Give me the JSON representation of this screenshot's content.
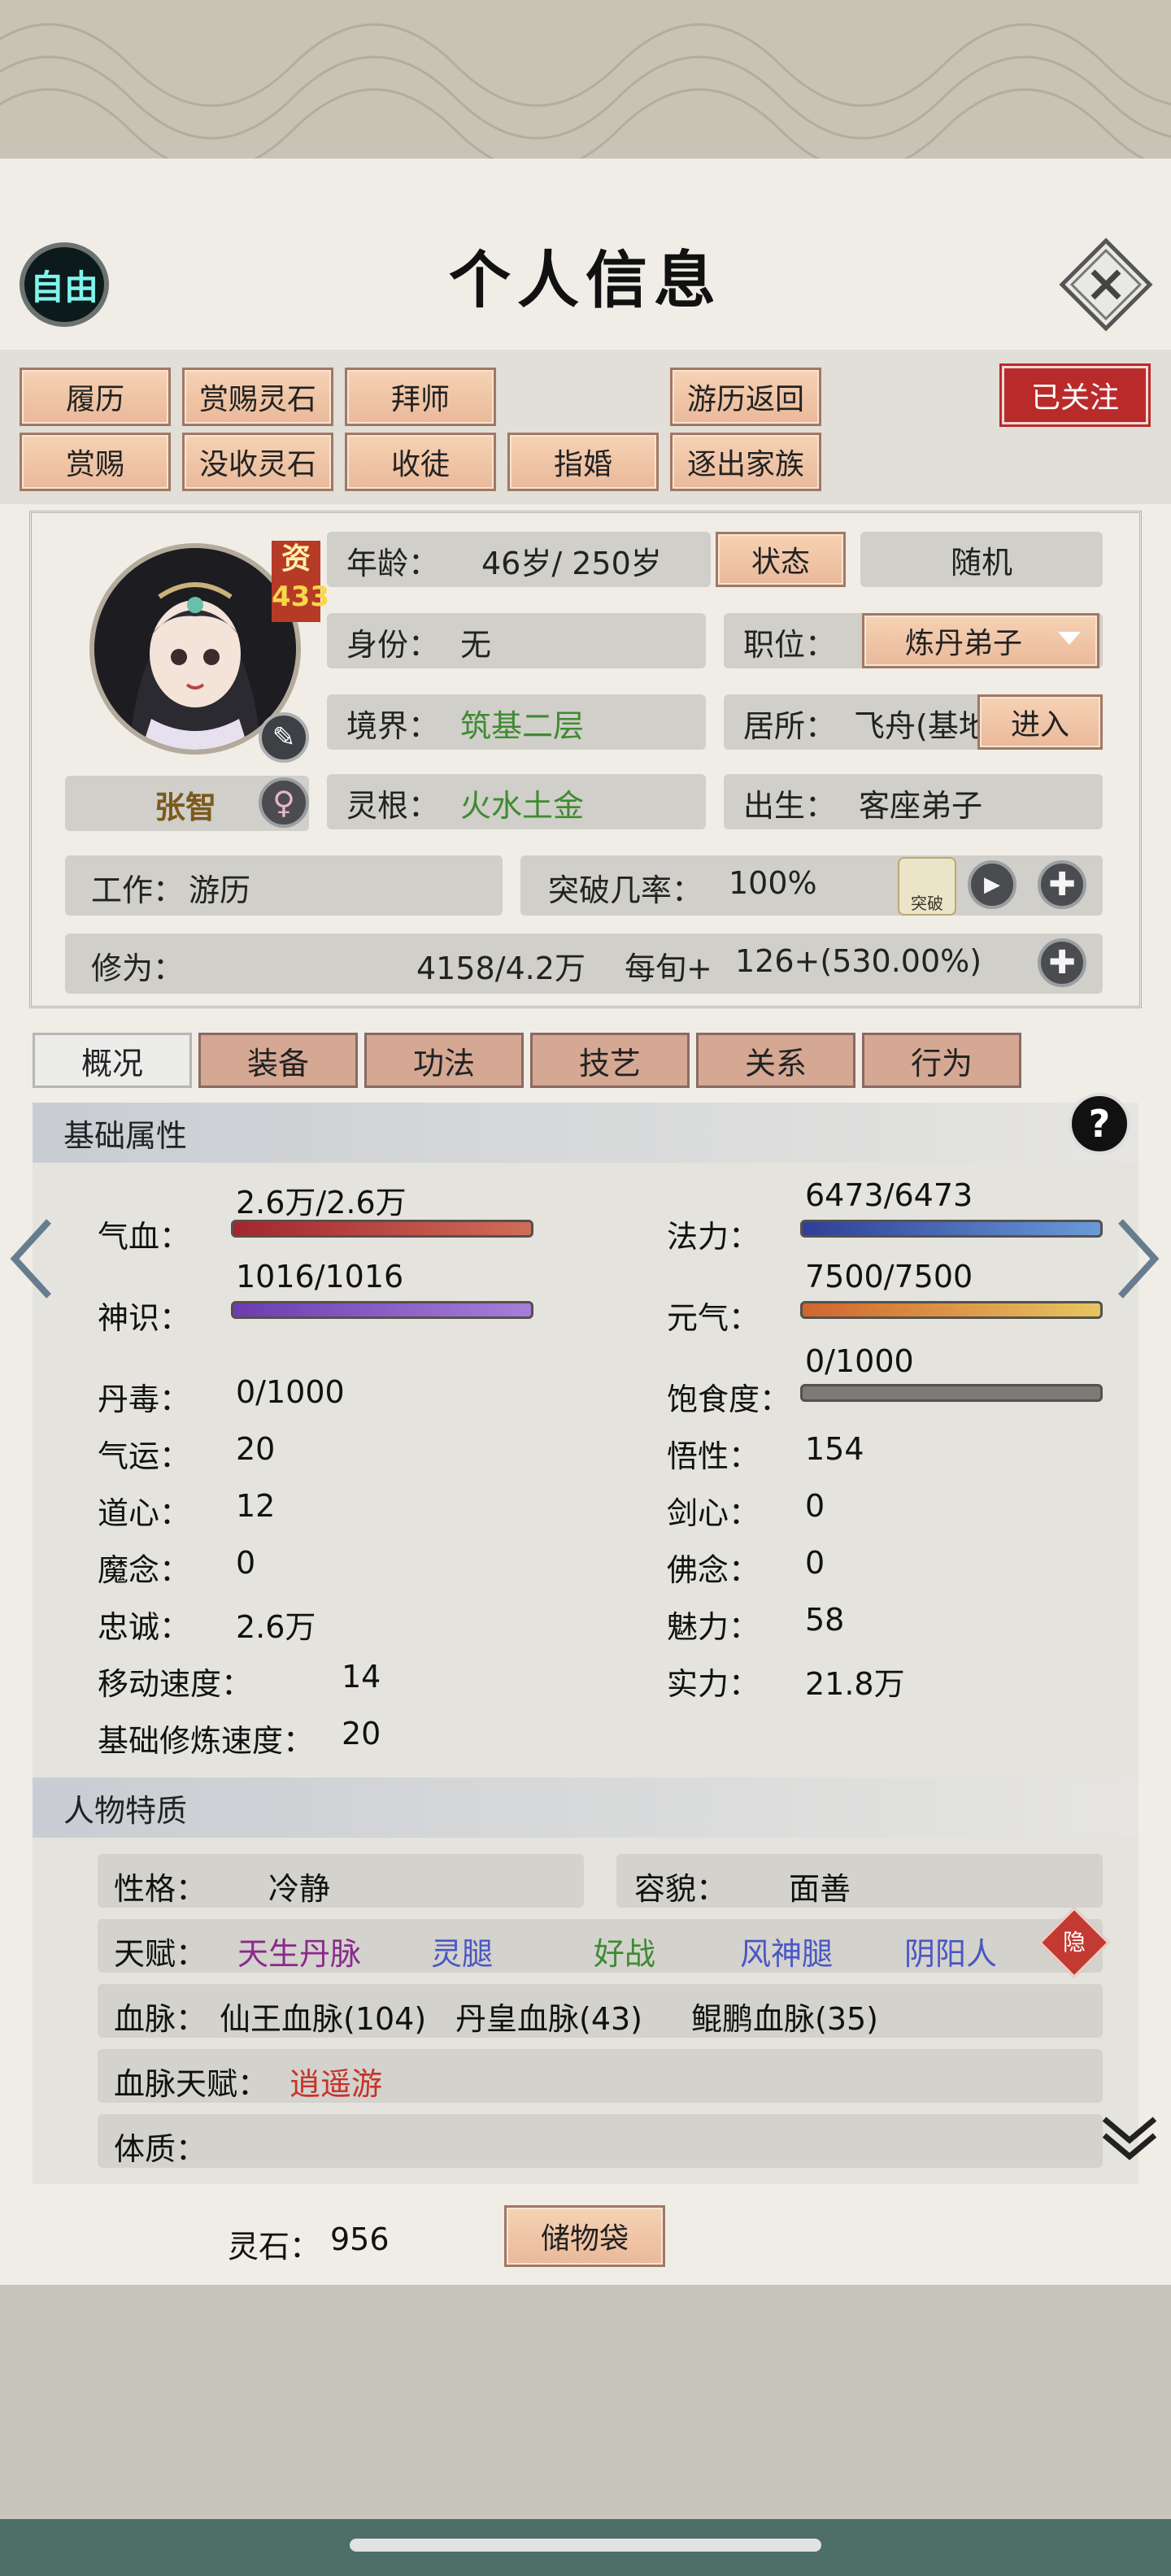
{
  "header": {
    "free_label": "自由",
    "title": "个人信息",
    "close_icon": "close-icon"
  },
  "actions": {
    "row1": [
      "履历",
      "赏赐灵石",
      "拜师",
      "游历返回"
    ],
    "row2": [
      "赏赐",
      "没收灵石",
      "收徒",
      "指婚",
      "逐出家族"
    ],
    "follow": "已关注"
  },
  "profile": {
    "aptitude_label": "资",
    "aptitude_value": "433",
    "name": "张智",
    "age_label": "年龄：",
    "age_value": "46岁/ 250岁",
    "state_button": "状态",
    "random_button": "随机",
    "identity_label": "身份：",
    "identity_value": "无",
    "position_label": "职位：",
    "position_value": "炼丹弟子",
    "realm_label": "境界：",
    "realm_value": "筑基二层",
    "residence_label": "居所：",
    "residence_value": "飞舟(基地",
    "enter_button": "进入",
    "root_label": "灵根：",
    "root_value": "火水土金",
    "birth_label": "出生：",
    "birth_value": "客座弟子",
    "work_label": "工作：",
    "work_value": "游历",
    "breakthrough_label": "突破几率：",
    "breakthrough_value": "100%",
    "breakthrough_icon_text": "突破",
    "cultivation_label": "修为：",
    "cultivation_value": "4158/4.2万",
    "per_turn_label": "每旬+",
    "per_turn_value": "126+(530.00%)"
  },
  "tabs": [
    "概况",
    "装备",
    "功法",
    "技艺",
    "关系",
    "行为"
  ],
  "basic": {
    "section_title": "基础属性",
    "qixue_label": "气血：",
    "qixue_value": "2.6万/2.6万",
    "qixue_fill": 1.0,
    "fali_label": "法力：",
    "fali_value": "6473/6473",
    "fali_fill": 1.0,
    "shenshi_label": "神识：",
    "shenshi_value": "1016/1016",
    "shenshi_fill": 1.0,
    "yuanqi_label": "元气：",
    "yuanqi_value": "7500/7500",
    "yuanqi_fill": 1.0,
    "baoshi_label": "饱食度：",
    "baoshi_value": "0/1000",
    "baoshi_fill": 0.0,
    "rows": [
      {
        "l": "丹毒：",
        "v": "0/1000"
      },
      {
        "l": "气运：",
        "v": "20",
        "r": "悟性：",
        "rv": "154"
      },
      {
        "l": "道心：",
        "v": "12",
        "r": "剑心：",
        "rv": "0"
      },
      {
        "l": "魔念：",
        "v": "0",
        "r": "佛念：",
        "rv": "0"
      },
      {
        "l": "忠诚：",
        "v": "2.6万",
        "r": "魅力：",
        "rv": "58"
      },
      {
        "l": "移动速度：",
        "v": "14",
        "r": "实力：",
        "rv": "21.8万"
      },
      {
        "l": "基础修炼速度：",
        "v": "20"
      }
    ]
  },
  "traits": {
    "section_title": "人物特质",
    "personality_label": "性格：",
    "personality_value": "冷静",
    "looks_label": "容貌：",
    "looks_value": "面善",
    "talent_label": "天赋：",
    "talents": [
      "天生丹脉",
      "灵腿",
      "好战",
      "风神腿",
      "阴阳人"
    ],
    "talent_colors": [
      "#8a2a8c",
      "#4a57c4",
      "#3f8a33",
      "#4a57c4",
      "#4a57c4"
    ],
    "hide_label": "隐",
    "bloodline_label": "血脉：",
    "bloodlines": [
      "仙王血脉(104)",
      "丹皇血脉(43)",
      "鲲鹏血脉(35)"
    ],
    "bloodline_talent_label": "血脉天赋：",
    "bloodline_talent_value": "逍遥游",
    "constitution_label": "体质："
  },
  "footer": {
    "spirit_stone_label": "灵石：",
    "spirit_stone_value": "956",
    "bag_button": "储物袋"
  }
}
